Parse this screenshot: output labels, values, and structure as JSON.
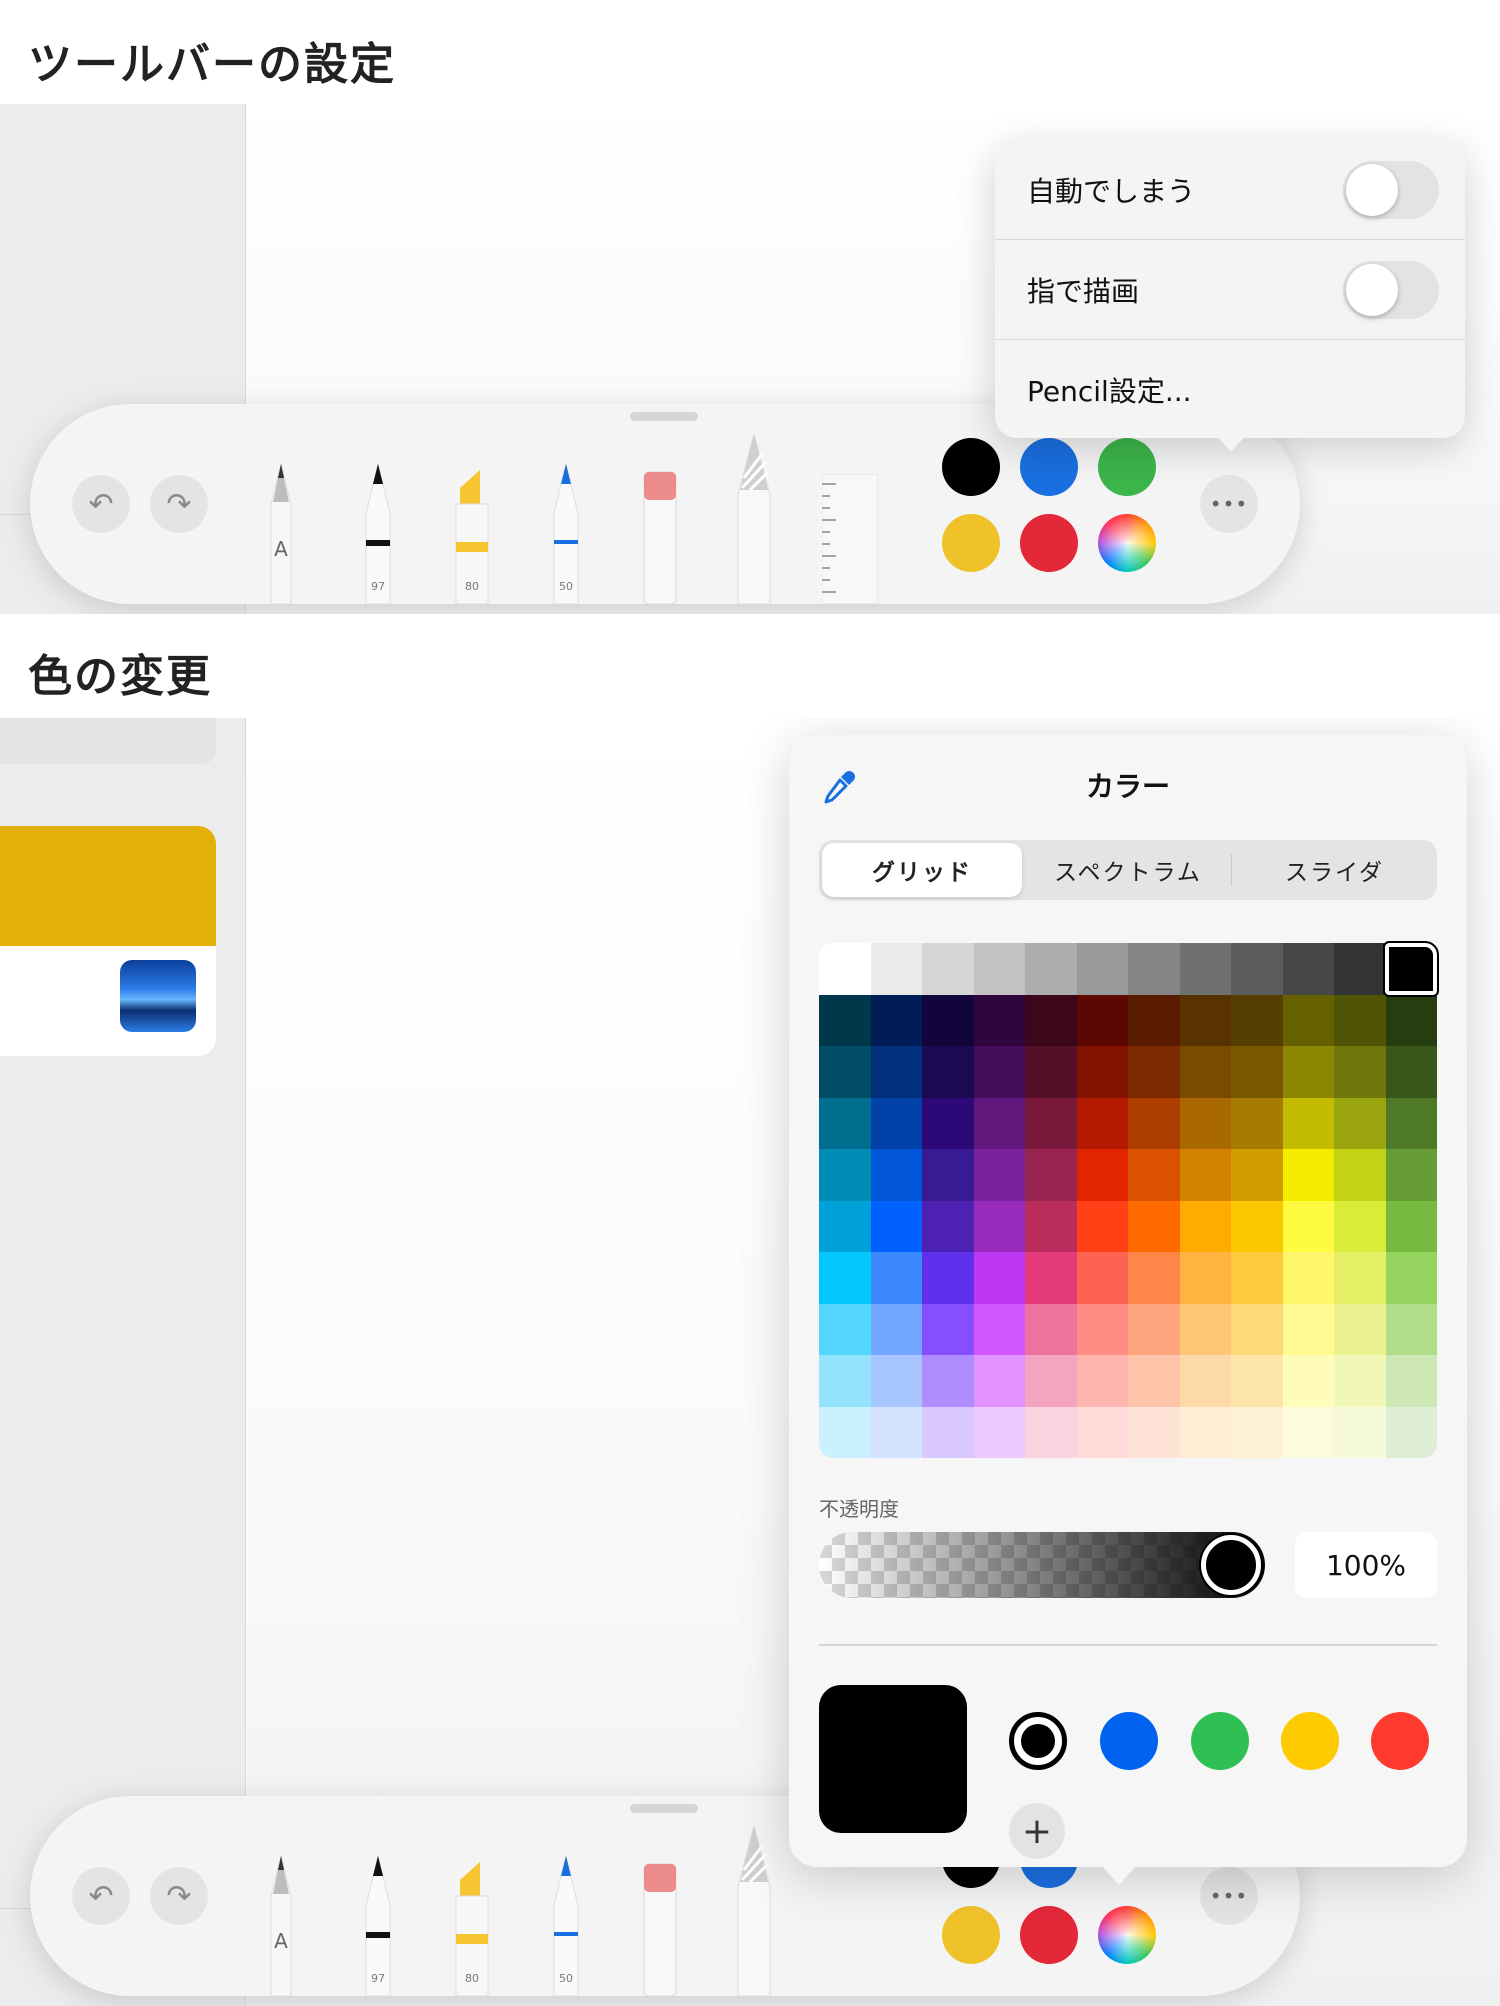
{
  "section1": {
    "heading": "ツールバーの設定"
  },
  "section2": {
    "heading": "色の変更"
  },
  "toolbar": {
    "undo_icon": "undo-arrow-icon",
    "redo_icon": "redo-arrow-icon",
    "tools": [
      {
        "name": "monoline-pen",
        "label": "A"
      },
      {
        "name": "pen",
        "label": "97"
      },
      {
        "name": "marker",
        "label": "80"
      },
      {
        "name": "pencil",
        "label": "50"
      },
      {
        "name": "eraser",
        "label": ""
      },
      {
        "name": "lasso",
        "label": ""
      },
      {
        "name": "ruler",
        "label": ""
      }
    ],
    "colors": [
      "#000000",
      "#1a6fe0",
      "#3cb54a",
      "#f0c22a",
      "#e3283a"
    ],
    "more_label": "•••"
  },
  "menu": {
    "items": [
      {
        "label": "自動でしまう",
        "toggle": false
      },
      {
        "label": "指で描画",
        "toggle": false
      },
      {
        "label": "Pencil設定..."
      }
    ]
  },
  "color_picker": {
    "title": "カラー",
    "tabs": [
      "グリッド",
      "スペクトラム",
      "スライダ"
    ],
    "active_tab": "グリッド",
    "opacity_label": "不透明度",
    "opacity_value": "100%",
    "selected_color": "#000000",
    "swatches": [
      "#000000",
      "#0063f0",
      "#2fc055",
      "#fecb00",
      "#ff3b30"
    ],
    "add_label": "+"
  },
  "sidebar": {
    "accent_color": "#e3b008"
  }
}
